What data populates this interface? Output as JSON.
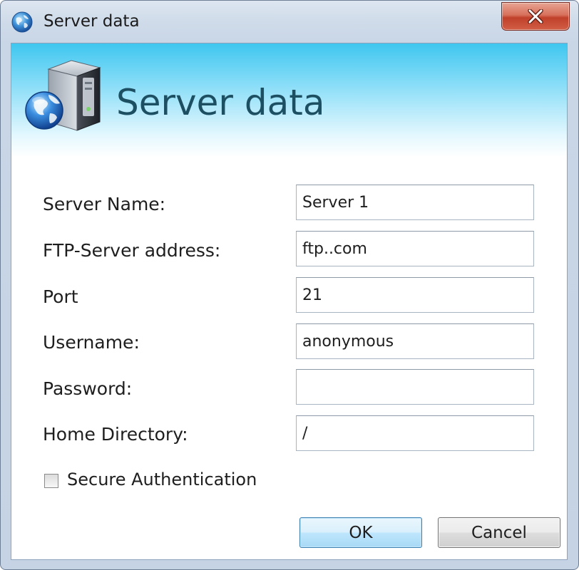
{
  "window": {
    "title": "Server data",
    "title_icon": "globe-icon",
    "close_icon": "close-icon"
  },
  "banner": {
    "title": "Server data",
    "icon": "server-globe-icon"
  },
  "form": {
    "fields": [
      {
        "label": "Server Name:",
        "value": "Server 1"
      },
      {
        "label": "FTP-Server address:",
        "value": "ftp..com"
      },
      {
        "label": "Port",
        "value": "21"
      },
      {
        "label": "Username:",
        "value": "anonymous"
      },
      {
        "label": "Password:",
        "value": ""
      },
      {
        "label": "Home Directory:",
        "value": "/"
      }
    ],
    "secure_auth": {
      "label": "Secure Authentication",
      "checked": false
    }
  },
  "buttons": {
    "ok": "OK",
    "cancel": "Cancel"
  },
  "colors": {
    "accent": "#3fc6ef",
    "banner_title": "#1d4f63",
    "close_button": "#c0402a"
  }
}
